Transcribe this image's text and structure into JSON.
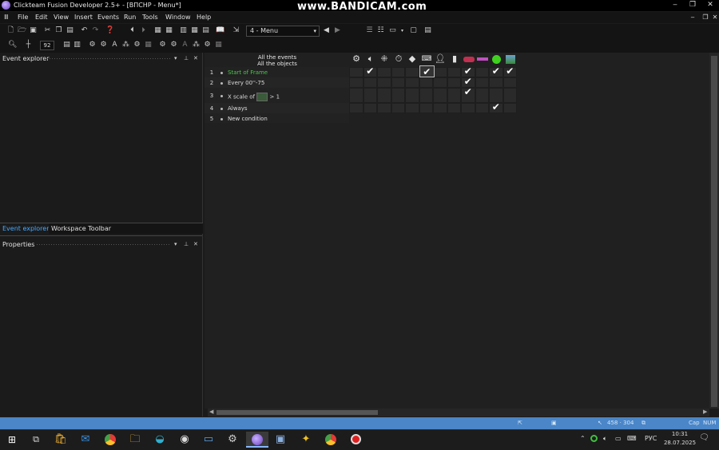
{
  "window": {
    "title": "Clickteam Fusion Developer 2.5+ - [ВПСНР - Menu*]",
    "watermark": "www.BANDICAM.com",
    "controls": {
      "minimize": "‒",
      "maximize": "❐",
      "close": "✕"
    },
    "doc_controls": {
      "minimize": "‒",
      "restore": "❐",
      "close": "✕"
    }
  },
  "menubar": {
    "items": [
      "File",
      "Edit",
      "View",
      "Insert",
      "Events",
      "Run",
      "Tools",
      "Window",
      "Help"
    ]
  },
  "toolbar": {
    "frame_select": "4 - Menu",
    "zoom_value": "92"
  },
  "event_explorer": {
    "title": "Event explorer",
    "tabs": [
      "Event explorer",
      "Workspace Toolbar"
    ]
  },
  "properties": {
    "title": "Properties"
  },
  "event_editor": {
    "header_line1": "All the events",
    "header_line2": "All the objects",
    "rows": [
      {
        "num": "1",
        "text": "Start of Frame",
        "color": "#4cc44c"
      },
      {
        "num": "2",
        "text": "Every 00''-75",
        "color": "#dddddd"
      },
      {
        "num": "3",
        "text_before": "X scale of",
        "text_after": "> 1",
        "color": "#dddddd"
      },
      {
        "num": "4",
        "text": "Always",
        "color": "#dddddd"
      },
      {
        "num": "5",
        "text": "New condition",
        "color": "#dddddd"
      }
    ],
    "object_icons": [
      "gear-icon",
      "speaker-icon",
      "puzzle-icon",
      "timer-icon",
      "create-icon",
      "keyboard-icon",
      "player-icon",
      "active-object-icon",
      "car-icon",
      "string-icon",
      "green-ball-icon",
      "backdrop-icon"
    ]
  },
  "statusbar": {
    "coords": "458 · 304",
    "caps": "Cap",
    "num": "NUM"
  },
  "taskbar": {
    "language": "РУС",
    "time": "10:31",
    "date": "28.07.2025"
  }
}
